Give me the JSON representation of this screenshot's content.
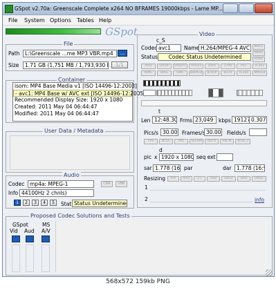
{
  "window": {
    "title": "GSpot v2.70a: Greenscale Complete x264 NO BFRAMES 19000kbps - Lame MP..."
  },
  "menu": [
    "File",
    "System",
    "Options",
    "Tables",
    "Help"
  ],
  "logo": {
    "text": "GSpot"
  },
  "file": {
    "title": "File",
    "path_label": "Path",
    "path": "L:\\Greenscale ...me MP3 VBR.mp4",
    "browse": "...",
    "size_label": "Size",
    "size": "1.71 GB (1,751 MB / 1,793,930 KB",
    "page": "1/1"
  },
  "container": {
    "title": "Container",
    "lines": [
      "isom: MP4 Base Media v1 [ISO 14496-12:2003]",
      "- avc1: MP4 Base w/ AVC ext [ISO 14496-12:2005]",
      "Recommended Display Size: 1920 x 1080",
      "Created:    2011 May 04   06:44:47",
      "Modified:   2011 May 04   06:44:47"
    ]
  },
  "userdata": {
    "title": "User Data / Metadata"
  },
  "audio": {
    "title": "Audio",
    "codec_label": "Codec",
    "codec": "mp4a: MPEG-1",
    "cbr": "CBR",
    "vbr": "VBR",
    "info_label": "Info",
    "info": "44100Hz  2 chnls)",
    "stat_label": "Stat",
    "stat": "Status Undetermined",
    "stream_buttons": [
      "1",
      "2",
      "3",
      "4",
      "5"
    ]
  },
  "proposed": {
    "title": "Proposed Codec Solutions and Tests",
    "gspot_label": "GSpot",
    "vid_label": "Vid",
    "aud_label": "Aud",
    "ms_label": "MS",
    "av_label": "A/V"
  },
  "video": {
    "title": "Video",
    "cs_label": "c_S",
    "codec_label": "Codec",
    "codec": "avc1",
    "name_label": "Name",
    "name": "H.264/MPEG-4 AVC",
    "status_label": "Status",
    "status": "Codec Status Undetermined",
    "side_btns": [
      "MPEG",
      "MP4V",
      "H264"
    ],
    "flag_row1": [
      "AVID",
      "DX/DP",
      "DVD/FF",
      "XVID/3",
      "DIVX",
      "2700",
      "PCC",
      "H.263"
    ],
    "flag_row2": [
      "RPAC",
      "QPEL",
      "GMC",
      "BDPACK",
      "B-VOP",
      "B170",
      "H.264",
      "MPEG4"
    ],
    "t_label": "t",
    "len_label": "Len",
    "len": "12:48.30",
    "frms_label": "Frms",
    "frms": "23,049",
    "kbps_label": "kbps",
    "kbps": "19127",
    "qf_label": "Qf",
    "qf": "0.307",
    "pics_label": "Pics/s",
    "pics": "30.000",
    "frames_label": "Frames/s",
    "frames": "30.000",
    "fields_label": "Fields/s",
    "fields": "",
    "fmt_btns": [
      "FPS",
      "NTSC",
      "PAL",
      "SECAM",
      "HDTV",
      "PAL-N",
      "NTSC-J"
    ],
    "d_label": "d",
    "pic_label": "pic",
    "pic_x": "x",
    "pic": "1920 x 1080",
    "seq_label": "seq ext",
    "seq": "",
    "sar_label": "sar",
    "sar": "1.778 (16:9)",
    "par_label": "par",
    "dar_label": "dar",
    "dar": "1.778 (16:9)",
    "resizing_label": "Resizing",
    "resize_btns": [
      "A/V",
      "A/V1",
      "1:1",
      "VSD",
      "SVCD",
      "DVD",
      "DVD2"
    ],
    "row1": "1",
    "row2": "2",
    "info_link": "info"
  },
  "statusbar": {
    "text": "568x572  159kb PNG"
  }
}
